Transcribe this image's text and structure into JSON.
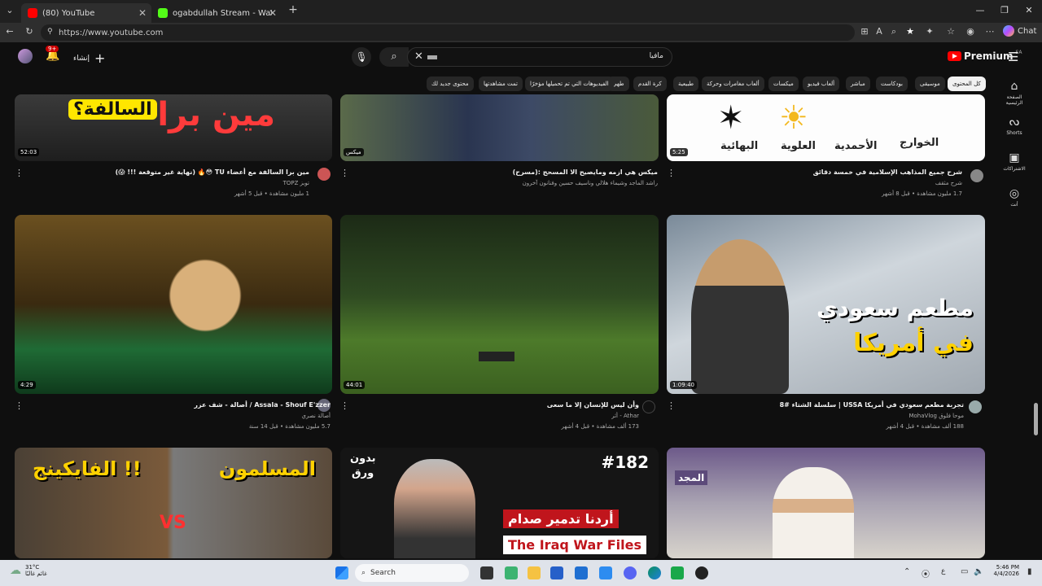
{
  "browser": {
    "tabs": [
      {
        "title": "(80) YouTube",
        "active": true
      },
      {
        "title": "ogabdullah Stream - Watch Live c",
        "active": false
      }
    ],
    "new_tab": "+",
    "url": "https://www.youtube.com",
    "chat_label": "Chat"
  },
  "youtube": {
    "logo_text": "Premium",
    "region": "SA",
    "search_value": "مافيا",
    "create_label": "إنشاء",
    "notification_count": "9+",
    "chips": [
      "كل المحتوى",
      "موسيقى",
      "بودكاست",
      "مباشر",
      "ألعاب فيديو",
      "ميكسات",
      "ألعاب مغامرات وحركة",
      "طبيعية",
      "كرة القدم",
      "طهي",
      "الفيديوهات التي تم تحميلها مؤخرًا",
      "تمت مشاهدتها",
      "محتوى جديد لك"
    ],
    "rail": [
      {
        "label": "الصفحة الرئيسية"
      },
      {
        "label": "Shorts"
      },
      {
        "label": "الاشتراكات"
      },
      {
        "label": "أنت"
      }
    ]
  },
  "videos": [
    {
      "title": "مين برا السالفة مع أعضاء TU 😳🔥 (نهاية غير متوقعة !!! 😱)",
      "channel": "توبز TOPZ",
      "stats": "1 مليون مشاهدة • قبل 5 أشهر",
      "duration": "52:03",
      "overlay": [
        "مين برا",
        "السالفة؟"
      ]
    },
    {
      "title": "ميكس هي ازمه ومايصيح الا المسحج :(مسرح)",
      "channel": "راشد الماجد وشيماء هلالي وناسيف حسين وفنانون آخرون",
      "stats": "",
      "duration": "ميكس"
    },
    {
      "title": "شرح جميع المذاهب الإسلامية في خمسة دقائق",
      "channel": "شرح مثقف",
      "stats": "1.7 مليون مشاهدة • قبل 8 أشهر",
      "duration": "5:25",
      "overlay": [
        "البهائية",
        "العلوية",
        "الأحمدية",
        "الخوارج"
      ]
    },
    {
      "title": "Assala - Shouf E'zzer / أصالة - شف عزر",
      "channel": "أصالة نصري",
      "stats": "5.7 مليون مشاهدة • قبل 14 سنة",
      "duration": "4:29"
    },
    {
      "title": "وأن ليس للإنسان إلا ما سعى",
      "channel": "Athar - أثر",
      "stats": "173 ألف مشاهدة • قبل 4 أشهر",
      "duration": "44:01"
    },
    {
      "title": "تجربة مطعم سعودي في أمريكا USSA | سلسلة الشتاء #8",
      "channel": "موحا فلوق MohaVlog",
      "stats": "188 ألف مشاهدة • قبل 4 أشهر",
      "duration": "1:09:40",
      "overlay": [
        "مطعم سعودي",
        "في أمريكا"
      ]
    },
    {
      "title": "",
      "channel": "",
      "stats": "",
      "duration": "",
      "overlay": [
        "الفايكينج !!",
        "المسلمون",
        "VS"
      ]
    },
    {
      "title": "",
      "channel": "",
      "stats": "",
      "duration": "",
      "overlay": [
        "بدون",
        "ورق",
        "#182",
        "أردنا تدمير صدام",
        "The Iraq War Files"
      ]
    },
    {
      "title": "",
      "channel": "",
      "stats": "",
      "duration": "",
      "overlay": [
        "المجد"
      ]
    }
  ],
  "taskbar": {
    "weather_temp": "31°C",
    "weather_desc": "غائم غالبًا",
    "search_label": "Search",
    "time": "5:46 PM",
    "date": "4/4/2026",
    "lang": "ع"
  }
}
